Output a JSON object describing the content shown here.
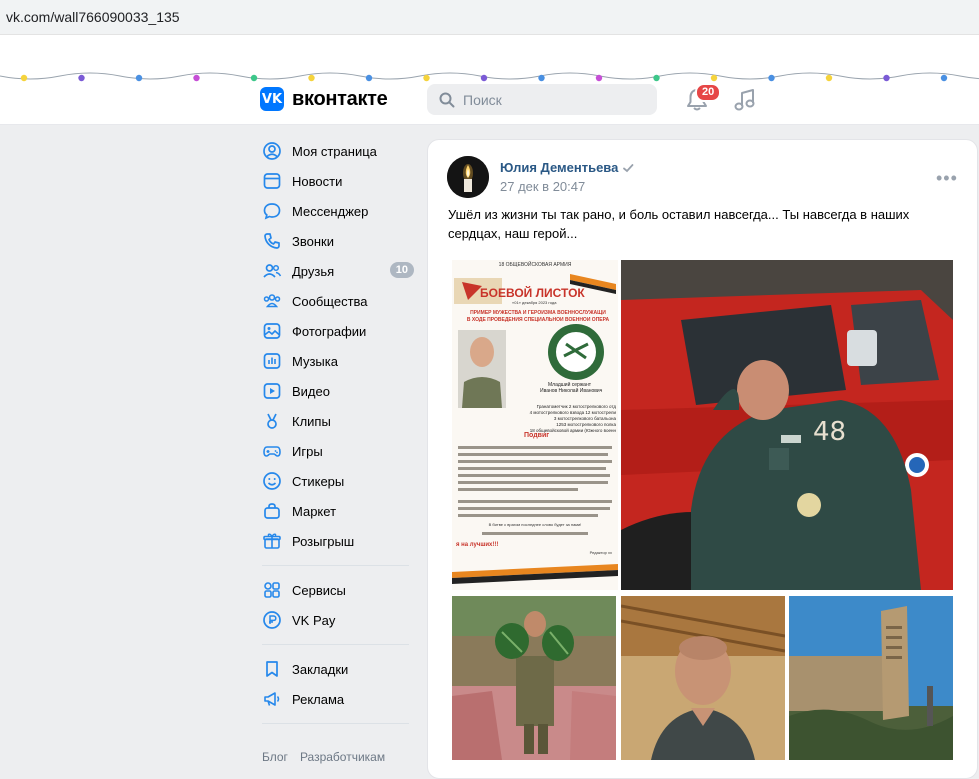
{
  "browser": {
    "url": "vk.com/wall766090033_135"
  },
  "header": {
    "logo_text": "вконтакте",
    "logo_mark": "VK",
    "search_placeholder": "Поиск",
    "notifications_count": "20",
    "icons": [
      "search-icon",
      "bell-icon",
      "music-icon"
    ],
    "accent_color": "#0077ff"
  },
  "sidebar": {
    "items": [
      {
        "label": "Моя страница",
        "icon": "profile-icon"
      },
      {
        "label": "Новости",
        "icon": "news-icon"
      },
      {
        "label": "Мессенджер",
        "icon": "messenger-icon"
      },
      {
        "label": "Звонки",
        "icon": "phone-icon"
      },
      {
        "label": "Друзья",
        "icon": "friends-icon",
        "count": "10"
      },
      {
        "label": "Сообщества",
        "icon": "communities-icon"
      },
      {
        "label": "Фотографии",
        "icon": "photos-icon"
      },
      {
        "label": "Музыка",
        "icon": "music-chart-icon"
      },
      {
        "label": "Видео",
        "icon": "video-icon"
      },
      {
        "label": "Клипы",
        "icon": "clips-icon"
      },
      {
        "label": "Игры",
        "icon": "gamepad-icon"
      },
      {
        "label": "Стикеры",
        "icon": "smile-icon"
      },
      {
        "label": "Маркет",
        "icon": "market-bag-icon"
      },
      {
        "label": "Розыгрыш",
        "icon": "gift-icon"
      }
    ],
    "services": [
      {
        "label": "Сервисы",
        "icon": "services-grid-icon"
      },
      {
        "label": "VK Pay",
        "icon": "vkpay-icon"
      }
    ],
    "extras": [
      {
        "label": "Закладки",
        "icon": "bookmark-icon"
      },
      {
        "label": "Реклама",
        "icon": "megaphone-icon"
      }
    ],
    "footer_links": [
      "Блог",
      "Разработчикам"
    ]
  },
  "post": {
    "author": "Юлия Дементьева",
    "date": "27 дек в 20:47",
    "text": "Ушёл из жизни ты так рано, и боль оставил навсегда... Ты навсегда в наших сердцах, наш герой...",
    "leaflet": {
      "army": "18 ОБЩЕВОЙСКОВАЯ АРМИЯ",
      "title": "БОЕВОЙ ЛИСТОК",
      "issue": "«01» декабря 2023 года",
      "subtitle1": "ПРИМЕР МУЖЕСТВА И ГЕРОИЗМА ВОЕННОСЛУЖАЩИ",
      "subtitle2": "В ХОДЕ ПРОВЕДЕНИЯ СПЕЦИАЛЬНОЙ ВОЕННОЙ ОПЕРА",
      "rank": "Младший сержант",
      "name": "Иванов Николай Иванович",
      "position_lines": [
        "Гранатометчик 2 мотострелкового отд",
        "4 мотострелкового взвода 12 мотострели",
        "3 мотострелкового батальона",
        "1253 мотострелкового полка",
        "18 общевойсковой армии (Южного военн"
      ],
      "section": "Подвиг",
      "closing": "В битве с врагом последнее слово будет за нами!",
      "slogan": "я на лучших!!!",
      "signature": "Редактор хх"
    }
  }
}
